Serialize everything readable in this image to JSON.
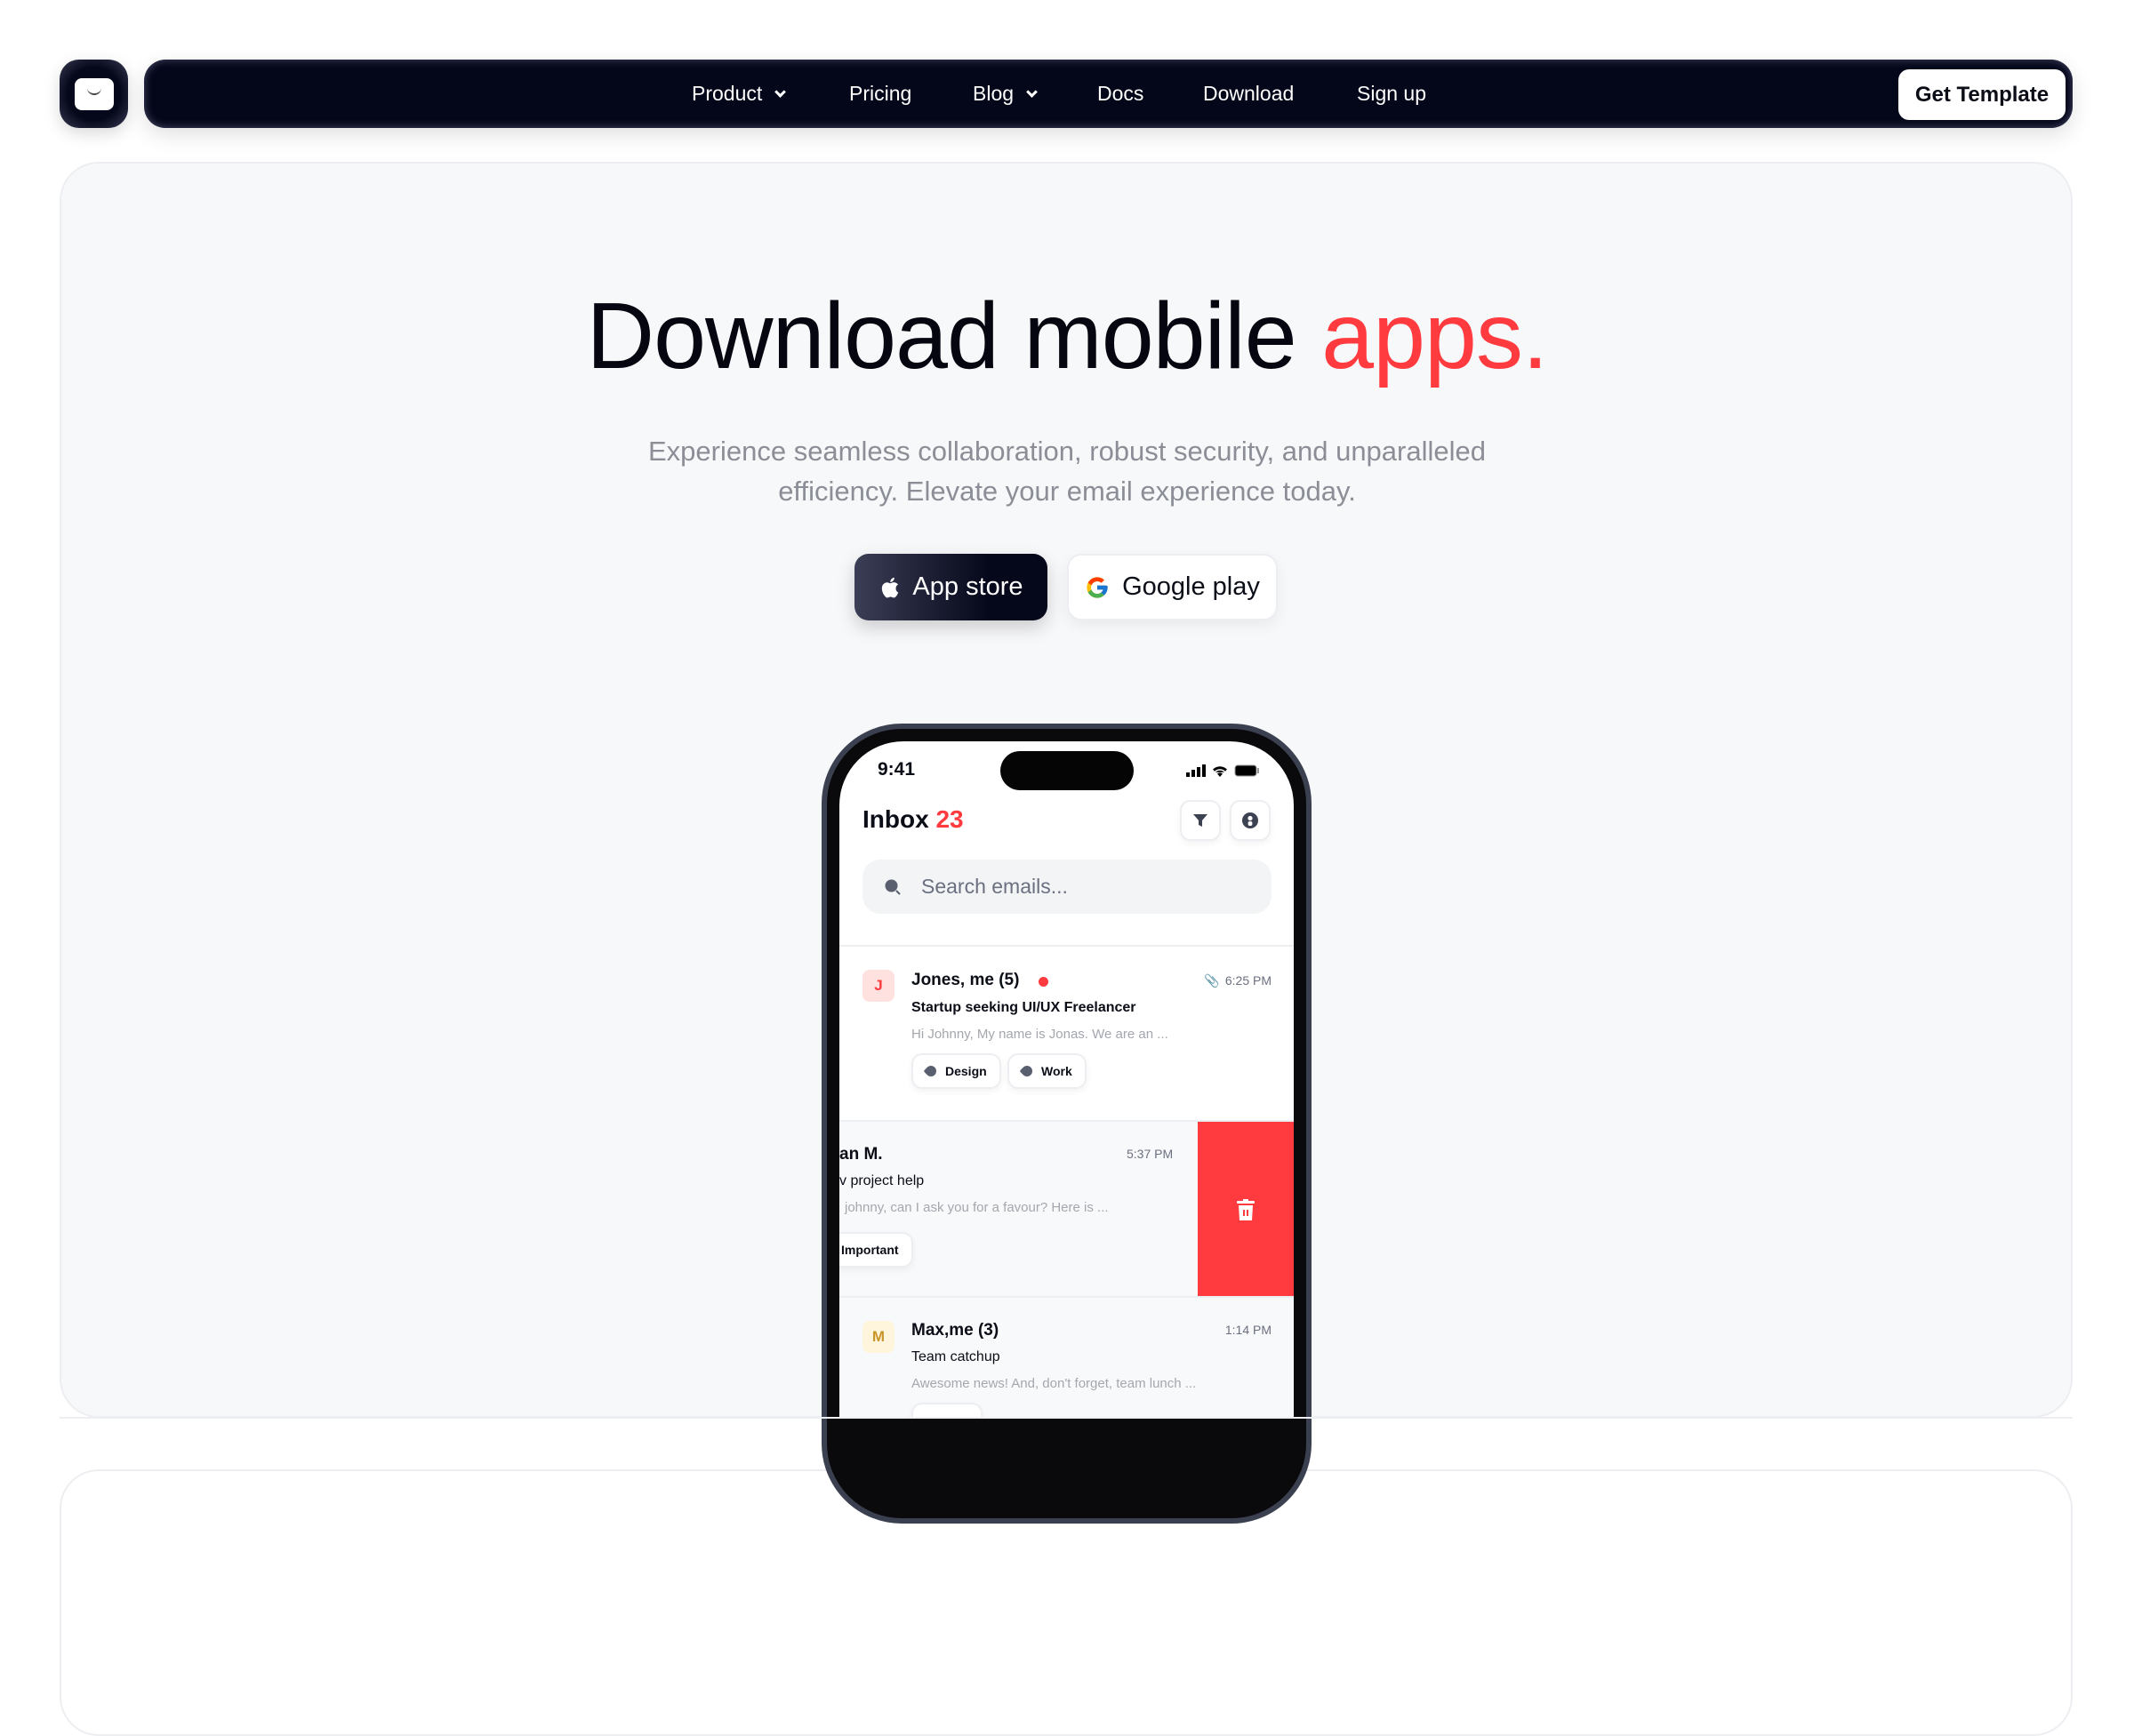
{
  "colors": {
    "accent": "#ff3b3f",
    "nav_bg": "#04061a",
    "hero_bg": "#f7f8fa"
  },
  "nav": {
    "logo_icon": "envelope-icon",
    "items": [
      {
        "label": "Product",
        "dropdown": true
      },
      {
        "label": "Pricing"
      },
      {
        "label": "Blog",
        "dropdown": true
      },
      {
        "label": "Docs"
      },
      {
        "label": "Download"
      },
      {
        "label": "Sign up"
      }
    ],
    "cta": "Get Template"
  },
  "hero": {
    "title_main": "Download mobile ",
    "title_accent": "apps.",
    "subtitle_line1": "Experience seamless collaboration, robust security, and unparalleled",
    "subtitle_line2": "efficiency. Elevate your email experience today.",
    "app_store": "App store",
    "google_play": "Google play"
  },
  "phone": {
    "time": "9:41",
    "inbox_label": "Inbox",
    "inbox_count": "23",
    "search_placeholder": "Search emails...",
    "emails": [
      {
        "avatar": "J",
        "name": "Jones, me (5)",
        "unread": true,
        "attachment": true,
        "time": "6:25 PM",
        "subject": "Startup seeking UI/UX Freelancer",
        "preview": "Hi Johnny, My name is Jonas. We are an ...",
        "tags": [
          "Design",
          "Work"
        ]
      },
      {
        "name": "an M.",
        "time": "5:37 PM",
        "subject": "v project help",
        "preview": "johnny, can I ask you for a favour? Here is ...",
        "tags": [
          "Important"
        ],
        "swiped": true,
        "action_icon": "trash-icon"
      },
      {
        "avatar": "M",
        "name": "Max,me (3)",
        "time": "1:14 PM",
        "subject": "Team catchup",
        "preview": "Awesome news! And, don't forget, team lunch ..."
      }
    ]
  }
}
